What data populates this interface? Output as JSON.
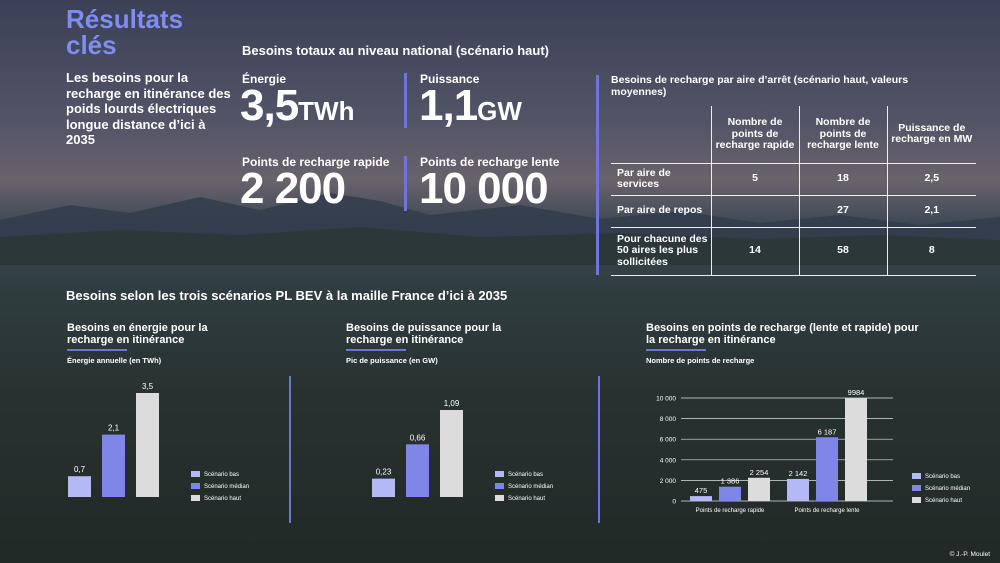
{
  "header": {
    "title": "Résultats clés",
    "intro": "Les besoins pour la recharge en itinérance des poids lourds électriques longue distance d’ici à 2035"
  },
  "national": {
    "title": "Besoins totaux au niveau national (scénario haut)",
    "energy": {
      "label": "Énergie",
      "value": "3,5",
      "unit": "TWh"
    },
    "power": {
      "label": "Puissance",
      "value": "1,1",
      "unit": "GW"
    },
    "fast": {
      "label": "Points de recharge rapide",
      "value": "2 200"
    },
    "slow": {
      "label": "Points de recharge lente",
      "value": "10 000"
    }
  },
  "table": {
    "title": "Besoins de recharge par aire d’arrêt (scénario haut, valeurs moyennes)",
    "columns": [
      "Nombre de points de recharge rapide",
      "Nombre de points de recharge lente",
      "Puissance de recharge en MW"
    ],
    "rows": [
      {
        "label": "Par aire de services",
        "values": [
          "5",
          "18",
          "2,5"
        ]
      },
      {
        "label": "Par aire de repos",
        "values": [
          "",
          "27",
          "2,1"
        ]
      },
      {
        "label": "Pour chacune des 50 aires les plus sollicitées",
        "values": [
          "14",
          "58",
          "8"
        ]
      }
    ]
  },
  "scenarios_title": "Besoins selon les trois scénarios PL BEV à la maille France d’ici à 2035",
  "colors": {
    "bas": "#b4b8f4",
    "median": "#7f86e6",
    "haut": "#dcdcdc",
    "accent": "#6b76d8"
  },
  "chart_data": [
    {
      "type": "bar",
      "title": "Besoins en énergie pour la recharge en itinérance",
      "ylabel": "Énergie annuelle (en TWh)",
      "categories": [
        "Scénario bas",
        "Scénario médian",
        "Scénario haut"
      ],
      "values": [
        0.7,
        2.1,
        3.5
      ],
      "labels": [
        "0,7",
        "2,1",
        "3,5"
      ],
      "legend": [
        "Scénario bas",
        "Scénario médian",
        "Scénario haut"
      ],
      "ylim": [
        0,
        3.5
      ]
    },
    {
      "type": "bar",
      "title": "Besoins de puissance pour la recharge en itinérance",
      "ylabel": "Pic de puissance (en GW)",
      "categories": [
        "Scénario bas",
        "Scénario médian",
        "Scénario haut"
      ],
      "values": [
        0.23,
        0.66,
        1.09
      ],
      "labels": [
        "0,23",
        "0,66",
        "1,09"
      ],
      "legend": [
        "Scénario bas",
        "Scénario médian",
        "Scénario haut"
      ],
      "ylim": [
        0,
        1.09
      ]
    },
    {
      "type": "bar",
      "title": "Besoins en points de recharge (lente et rapide) pour la recharge en itinérance",
      "ylabel": "Nombre de points de recharge",
      "categories": [
        "Points de recharge rapide",
        "Points de recharge lente"
      ],
      "series": [
        {
          "name": "Scénario bas",
          "values": [
            475,
            2142
          ],
          "labels": [
            "475",
            "2 142"
          ]
        },
        {
          "name": "Scénario médian",
          "values": [
            1386,
            6187
          ],
          "labels": [
            "1 386",
            "6 187"
          ]
        },
        {
          "name": "Scénario haut",
          "values": [
            2254,
            9984
          ],
          "labels": [
            "2 254",
            "9984"
          ]
        }
      ],
      "yticks": [
        0,
        2000,
        4000,
        6000,
        8000,
        10000
      ],
      "ytick_labels": [
        "0",
        "2 000",
        "4 000",
        "6 000",
        "8 000",
        "10 000"
      ],
      "ylim": [
        0,
        10000
      ],
      "grid": true,
      "legend": [
        "Scénario bas",
        "Scénario médian",
        "Scénario haut"
      ]
    }
  ],
  "credit": "© J.-P. Moulet"
}
